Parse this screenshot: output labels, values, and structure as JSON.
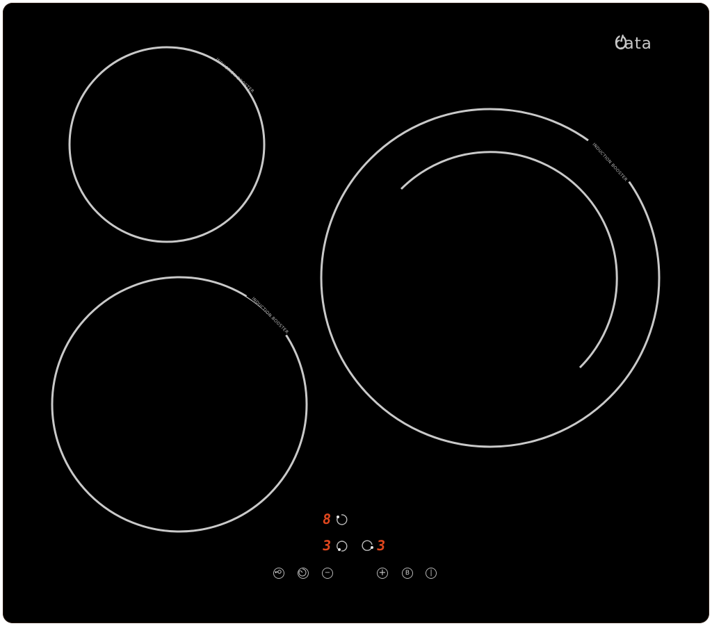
{
  "brand": {
    "name": "cata",
    "mark": "cata-logo-mark-icon"
  },
  "zones": [
    {
      "id": "top-left",
      "label": "INDUCTION BOOSTER"
    },
    {
      "id": "bottom-left",
      "label": "INDUCTION BOOSTER"
    },
    {
      "id": "right",
      "label": "INDUCTION BOOSTER"
    }
  ],
  "displays": {
    "top": "8",
    "bottom_left": "3",
    "bottom_right": "3"
  },
  "controls": {
    "lock": "lock-key-icon",
    "timer": "timer-icon",
    "minus": "−",
    "plus": "+",
    "booster": "B",
    "power": "|"
  },
  "colors": {
    "glass": "#000000",
    "ring": "#c9c9c9",
    "display": "#e0471e"
  }
}
